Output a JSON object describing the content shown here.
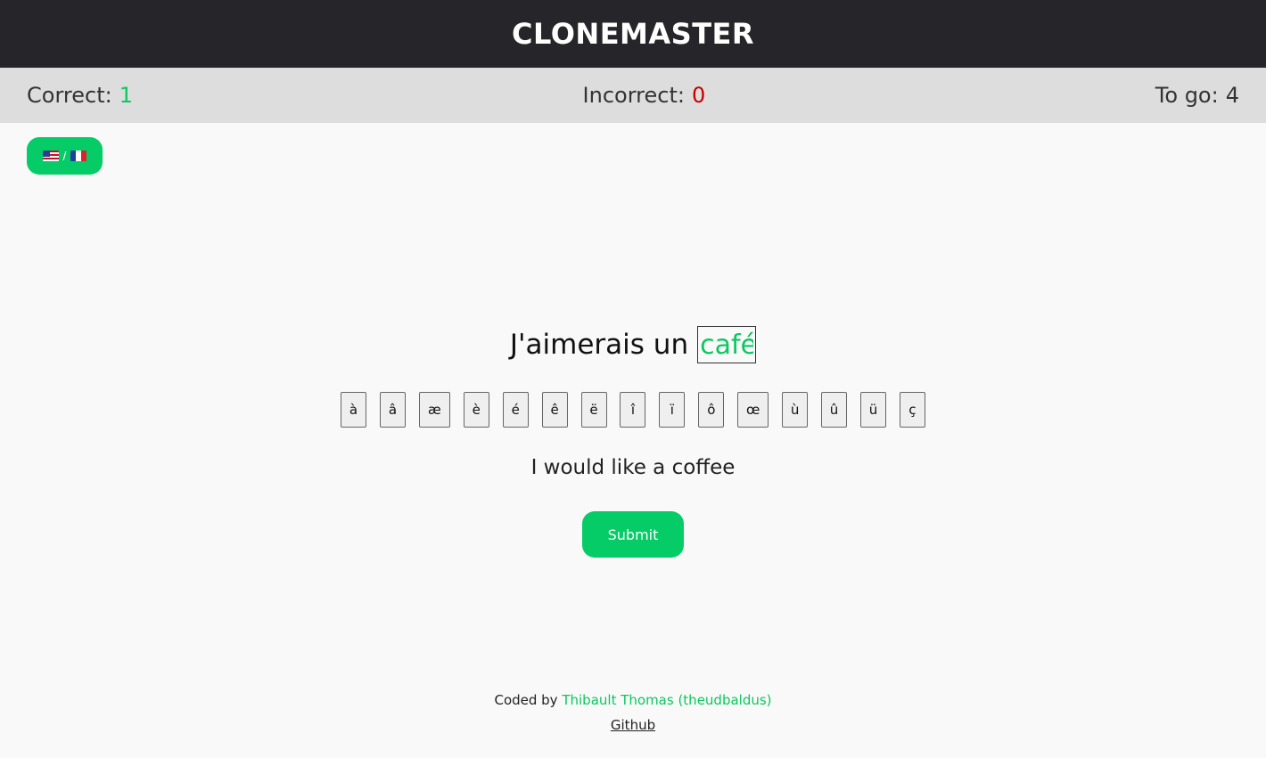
{
  "header": {
    "title": "CLONEMASTER"
  },
  "scores": {
    "correct_label": "Correct:",
    "correct_value": "1",
    "incorrect_label": "Incorrect:",
    "incorrect_value": "0",
    "togo_label": "To go:",
    "togo_value": "4"
  },
  "lang_toggle": {
    "separator": "/",
    "from_flag": "us-flag-icon",
    "to_flag": "fr-flag-icon"
  },
  "exercise": {
    "sentence_prefix": "J'aimerais un",
    "answer_value": "café",
    "translation": "I would like a coffee"
  },
  "accents": [
    "à",
    "â",
    "æ",
    "è",
    "é",
    "ê",
    "ë",
    "î",
    "ï",
    "ô",
    "œ",
    "ù",
    "û",
    "ü",
    "ç"
  ],
  "submit_label": "Submit",
  "footer": {
    "coded_by": "Coded by",
    "author": "Thibault Thomas (theudbaldus)",
    "github": "Github"
  },
  "colors": {
    "accent": "#05cc66",
    "header_bg": "#26262a",
    "correct": "#0cc85f",
    "incorrect": "#c40000"
  }
}
